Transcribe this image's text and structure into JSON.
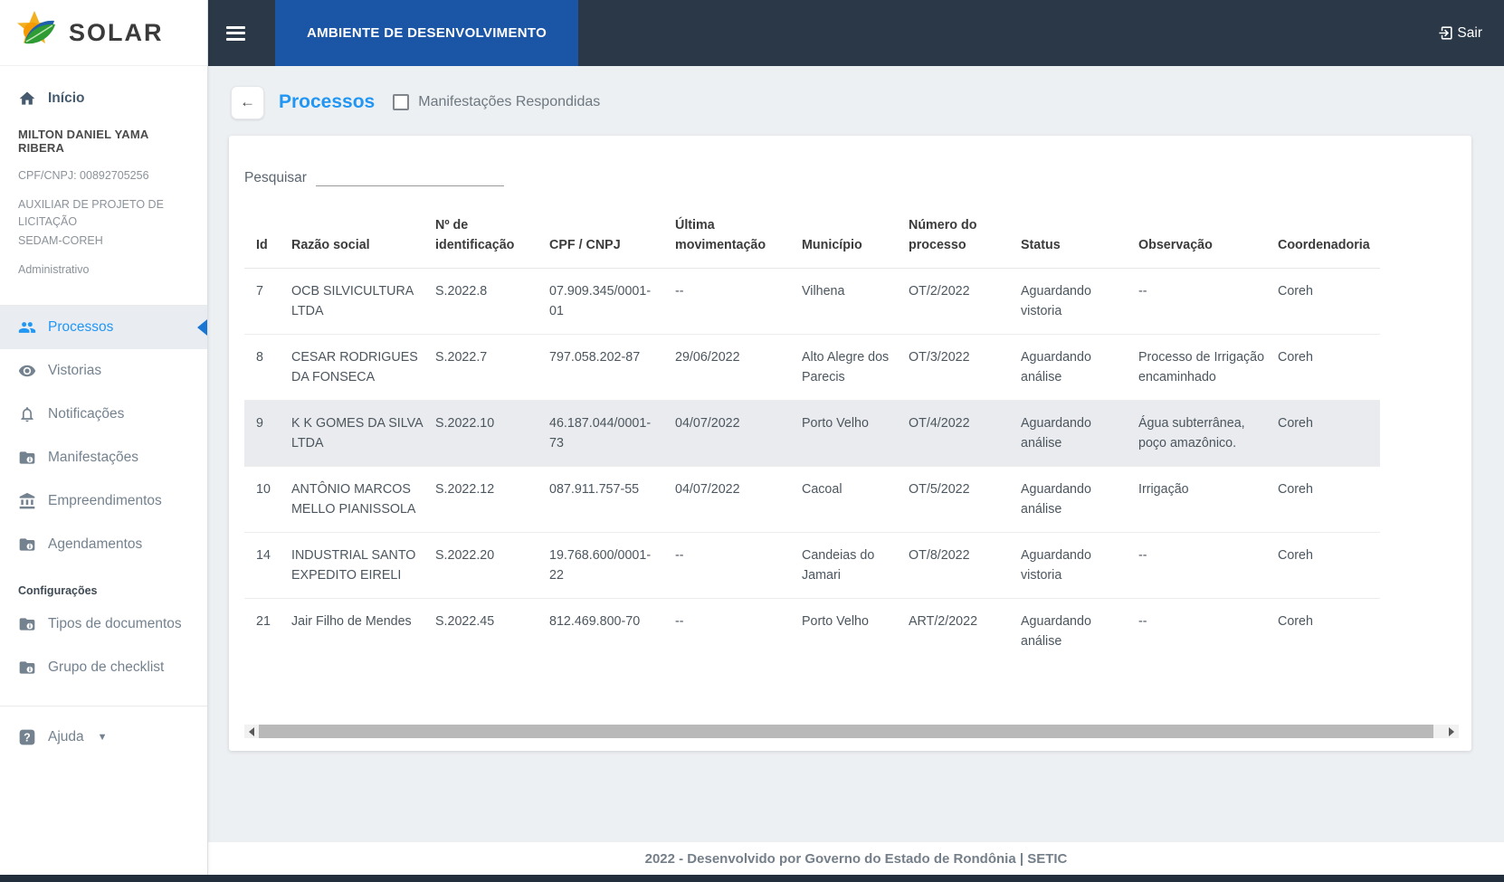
{
  "brand": {
    "name": "SOLAR"
  },
  "topbar": {
    "env_label": "AMBIENTE DE DESENVOLVIMENTO",
    "logout_label": "Sair"
  },
  "sidebar": {
    "home": {
      "label": "Início"
    },
    "user": {
      "name": "MILTON DANIEL YAMA RIBERA",
      "cpf": "CPF/CNPJ: 00892705256",
      "role_line1": "AUXILIAR DE PROJETO DE LICITAÇÃO",
      "role_line2": "SEDAM-COREH",
      "profile": "Administrativo"
    },
    "menu": [
      {
        "label": "Processos",
        "icon": "people-icon",
        "active": true
      },
      {
        "label": "Vistorias",
        "icon": "eye-icon",
        "active": false
      },
      {
        "label": "Notificações",
        "icon": "bell-icon",
        "active": false
      },
      {
        "label": "Manifestações",
        "icon": "folder-info-icon",
        "active": false
      },
      {
        "label": "Empreendimentos",
        "icon": "bank-icon",
        "active": false
      },
      {
        "label": "Agendamentos",
        "icon": "folder-info-icon",
        "active": false
      }
    ],
    "settings_header": "Configurações",
    "settings_menu": [
      {
        "label": "Tipos de documentos",
        "icon": "folder-info-icon",
        "active": false
      },
      {
        "label": "Grupo de checklist",
        "icon": "folder-info-icon",
        "active": false
      }
    ],
    "help": {
      "label": "Ajuda"
    }
  },
  "page": {
    "title": "Processos",
    "filter_checkbox_label": "Manifestações Respondidas",
    "filter_checkbox_checked": false,
    "search_label": "Pesquisar",
    "search_value": ""
  },
  "table": {
    "headers": [
      "Id",
      "Razão social",
      "Nº de identificação",
      "CPF / CNPJ",
      "Última movimentação",
      "Município",
      "Número do processo",
      "Status",
      "Observação",
      "Coordenadoria"
    ],
    "rows": [
      {
        "id": "7",
        "razao": "OCB SILVICULTURA LTDA",
        "ident": "S.2022.8",
        "cpf": "07.909.345/0001-01",
        "mov": "--",
        "municipio": "Vilhena",
        "processo": "OT/2/2022",
        "status": "Aguardando vistoria",
        "obs": "--",
        "coord": "Coreh",
        "highlight": false
      },
      {
        "id": "8",
        "razao": "CESAR RODRIGUES DA FONSECA",
        "ident": "S.2022.7",
        "cpf": "797.058.202-87",
        "mov": "29/06/2022",
        "municipio": "Alto Alegre dos Parecis",
        "processo": "OT/3/2022",
        "status": "Aguardando análise",
        "obs": "Processo de Irrigação encaminhado",
        "coord": "Coreh",
        "highlight": false
      },
      {
        "id": "9",
        "razao": "K K GOMES DA SILVA LTDA",
        "ident": "S.2022.10",
        "cpf": "46.187.044/0001-73",
        "mov": "04/07/2022",
        "municipio": "Porto Velho",
        "processo": "OT/4/2022",
        "status": "Aguardando análise",
        "obs": "Água subterrânea, poço amazônico.",
        "coord": "Coreh",
        "highlight": true
      },
      {
        "id": "10",
        "razao": "ANTÔNIO MARCOS MELLO PIANISSOLA",
        "ident": "S.2022.12",
        "cpf": "087.911.757-55",
        "mov": "04/07/2022",
        "municipio": "Cacoal",
        "processo": "OT/5/2022",
        "status": "Aguardando análise",
        "obs": "Irrigação",
        "coord": "Coreh",
        "highlight": false
      },
      {
        "id": "14",
        "razao": "INDUSTRIAL SANTO EXPEDITO EIRELI",
        "ident": "S.2022.20",
        "cpf": "19.768.600/0001-22",
        "mov": "--",
        "municipio": "Candeias do Jamari",
        "processo": "OT/8/2022",
        "status": "Aguardando vistoria",
        "obs": "--",
        "coord": "Coreh",
        "highlight": false
      },
      {
        "id": "21",
        "razao": "Jair Filho de Mendes",
        "ident": "S.2022.45",
        "cpf": "812.469.800-70",
        "mov": "--",
        "municipio": "Porto Velho",
        "processo": "ART/2/2022",
        "status": "Aguardando análise",
        "obs": "--",
        "coord": "Coreh",
        "highlight": false
      }
    ]
  },
  "footer": {
    "text": "2022 - Desenvolvido por Governo do Estado de Rondônia | SETIC"
  },
  "colors": {
    "topbar": "#2a3847",
    "env_box": "#1b55a5",
    "accent_blue": "#2196f3",
    "active_item_bg": "#e9edf2",
    "highlight_row": "#e9ebee",
    "bottom_bar": "#222e3c",
    "card_bg": "#ffffff",
    "page_bg": "#edf0f3"
  }
}
